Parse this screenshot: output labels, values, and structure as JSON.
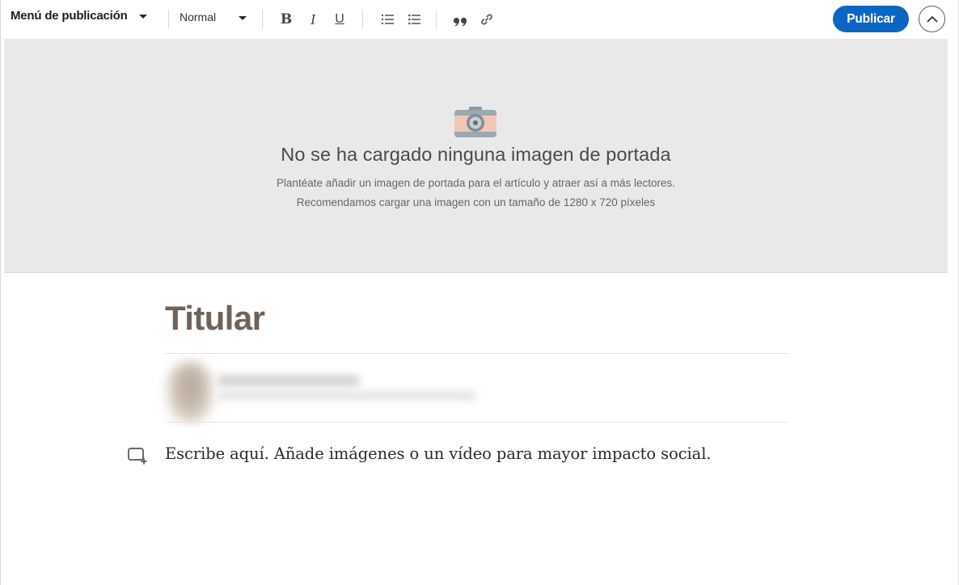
{
  "toolbar": {
    "publish_menu_label": "Menú de publicación",
    "text_style_value": "Normal",
    "bold_label": "B",
    "italic_label": "I",
    "underline_label": "U",
    "quote_label": "❞",
    "publish_label": "Publicar",
    "icons": [
      "chevron-down-icon",
      "numbered-list-icon",
      "bulleted-list-icon",
      "quote-icon",
      "link-icon",
      "chevron-up-icon"
    ]
  },
  "cover": {
    "icon": "camera-icon",
    "title": "No se ha cargado ninguna imagen de portada",
    "line1": "Plantéate añadir un imagen de portada para el artículo y atraer así a más lectores.",
    "line2": "Recomendamos cargar una imagen con un tamaño de 1280 x 720 píxeles"
  },
  "article": {
    "headline_placeholder": "Titular",
    "body_placeholder": "Escribe aquí. Añade imágenes o un vídeo para mayor impacto social.",
    "add_media_icon": "add-media-icon"
  },
  "colors": {
    "accent": "#0a66c2",
    "cover_bg": "#e9e9e9",
    "headline": "#6f6259"
  }
}
